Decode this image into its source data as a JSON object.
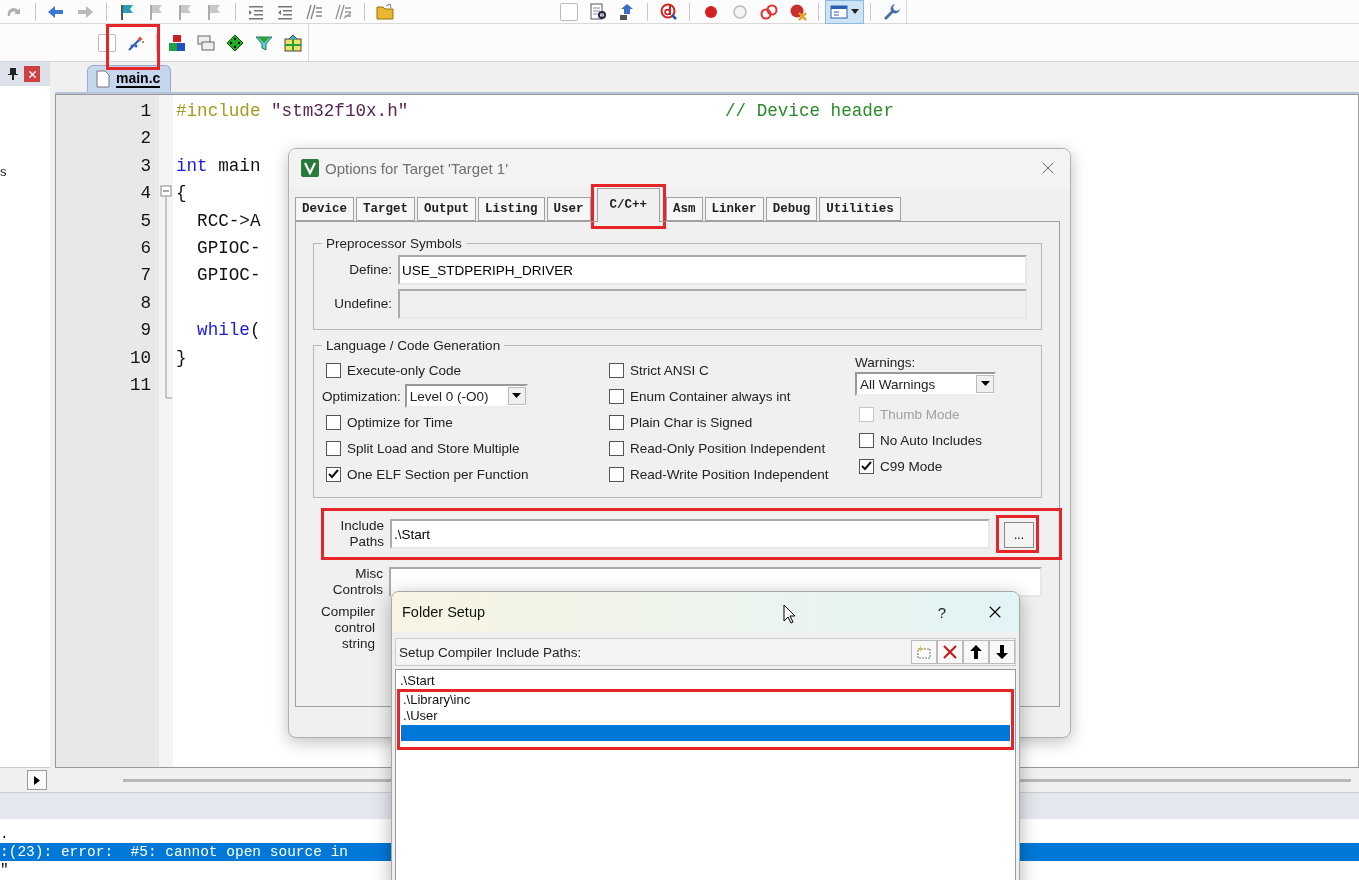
{
  "project_panel": {
    "text": "s"
  },
  "editor": {
    "tabs": [
      {
        "label": "main.c",
        "selected": true
      }
    ],
    "lines": [
      {
        "number": "1",
        "segments": [
          {
            "kind": "directive",
            "text": "#include"
          },
          {
            "kind": "string",
            "text": " \"stm32f10x.h\""
          },
          {
            "kind": "comment",
            "text": "                              // Device header"
          }
        ]
      },
      {
        "number": "2"
      },
      {
        "number": "3",
        "segments": [
          {
            "kind": "keyword",
            "text": "int"
          },
          {
            "kind": "plain",
            "text": " main"
          }
        ]
      },
      {
        "number": "4",
        "segments": [
          {
            "kind": "plain",
            "text": "{"
          }
        ]
      },
      {
        "number": "5",
        "segments": [
          {
            "kind": "plain",
            "text": "  RCC->A"
          }
        ]
      },
      {
        "number": "6",
        "segments": [
          {
            "kind": "plain",
            "text": "  GPIOC-"
          }
        ]
      },
      {
        "number": "7",
        "segments": [
          {
            "kind": "plain",
            "text": "  GPIOC-"
          }
        ]
      },
      {
        "number": "8"
      },
      {
        "number": "9",
        "segments": [
          {
            "kind": "keyword",
            "text": "  while"
          },
          {
            "kind": "plain",
            "text": "("
          }
        ]
      },
      {
        "number": "10",
        "segments": [
          {
            "kind": "plain",
            "text": "}"
          }
        ]
      },
      {
        "number": "11"
      }
    ]
  },
  "output": {
    "lines": [
      {
        "text": ".",
        "selected": false
      },
      {
        "text": ":(23): error:  #5: cannot open source in",
        "selected": true
      },
      {
        "text": "\"",
        "selected": false
      }
    ]
  },
  "options_dialog": {
    "title": "Options for Target 'Target 1'",
    "tabs": [
      {
        "label": "Device",
        "selected": false
      },
      {
        "label": "Target",
        "selected": false
      },
      {
        "label": "Output",
        "selected": false
      },
      {
        "label": "Listing",
        "selected": false
      },
      {
        "label": "User",
        "selected": false
      },
      {
        "label": "C/C++",
        "selected": true
      },
      {
        "label": "Asm",
        "selected": false
      },
      {
        "label": "Linker",
        "selected": false
      },
      {
        "label": "Debug",
        "selected": false
      },
      {
        "label": "Utilities",
        "selected": false
      }
    ],
    "preprocessor": {
      "title": "Preprocessor Symbols",
      "fields": [
        {
          "label": "Define:",
          "value": "USE_STDPERIPH_DRIVER",
          "disabled": false
        },
        {
          "label": "Undefine:",
          "disabled": true
        }
      ]
    },
    "language": {
      "title": "Language / Code Generation",
      "columns": [
        {
          "items": [
            {
              "kind": "checkbox",
              "label": "Execute-only Code",
              "checked": false,
              "disabled": false
            },
            {
              "kind": "select",
              "label": "Optimization:",
              "value": "Level 0 (-O0)"
            },
            {
              "kind": "checkbox",
              "label": "Optimize for Time",
              "checked": false,
              "disabled": false
            },
            {
              "kind": "checkbox",
              "label": "Split Load and Store Multiple",
              "checked": false,
              "disabled": false
            },
            {
              "kind": "checkbox",
              "label": "One ELF Section per Function",
              "checked": true,
              "disabled": false
            }
          ]
        },
        {
          "items": [
            {
              "kind": "checkbox",
              "label": "Strict ANSI C",
              "checked": false,
              "disabled": false
            },
            {
              "kind": "checkbox",
              "label": "Enum Container always int",
              "checked": false,
              "disabled": false
            },
            {
              "kind": "checkbox",
              "label": "Plain Char is Signed",
              "checked": false,
              "disabled": false
            },
            {
              "kind": "checkbox",
              "label": "Read-Only Position Independent",
              "checked": false,
              "disabled": false
            },
            {
              "kind": "checkbox",
              "label": "Read-Write Position Independent",
              "checked": false,
              "disabled": false
            }
          ]
        },
        {
          "items": [
            {
              "kind": "caption",
              "text": "Warnings:"
            },
            {
              "kind": "dropdown",
              "value": "All Warnings"
            },
            {
              "kind": "checkbox",
              "label": "Thumb Mode",
              "checked": false,
              "disabled": true
            },
            {
              "kind": "checkbox",
              "label": "No Auto Includes",
              "checked": false,
              "disabled": false
            },
            {
              "kind": "checkbox",
              "label": "C99 Mode",
              "checked": true,
              "disabled": false
            }
          ]
        }
      ]
    },
    "include_paths": {
      "label": "Include Paths",
      "value": ".\\Start",
      "browse": "..."
    },
    "misc_controls": {
      "label": "Misc Controls"
    },
    "compiler_string": {
      "label": "Compiler control string"
    }
  },
  "folder_dialog": {
    "title": "Folder Setup",
    "help": "?",
    "header": "Setup Compiler Include Paths:",
    "paths": [
      {
        "text": ".\\Start",
        "selected": false
      },
      {
        "text": ".\\Library\\inc",
        "selected": false
      },
      {
        "text": ".\\User",
        "selected": false
      },
      {
        "selected": true
      }
    ]
  }
}
